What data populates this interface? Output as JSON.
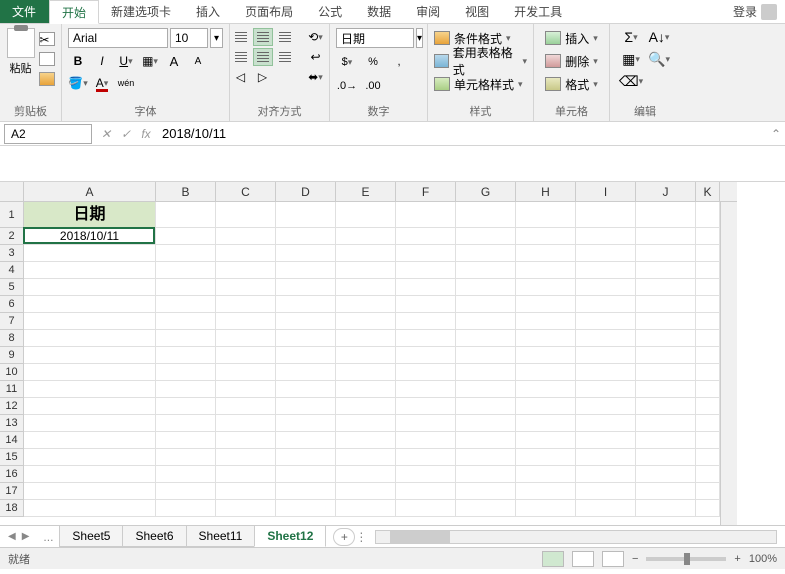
{
  "tabs": {
    "file": "文件",
    "home": "开始",
    "newtab": "新建选项卡",
    "insert": "插入",
    "layout": "页面布局",
    "formula": "公式",
    "data": "数据",
    "review": "审阅",
    "view": "视图",
    "dev": "开发工具",
    "login": "登录"
  },
  "ribbon": {
    "clipboard": {
      "label": "剪贴板",
      "paste": "粘贴"
    },
    "font": {
      "label": "字体",
      "name": "Arial",
      "size": "10",
      "bold": "B",
      "italic": "I",
      "underline": "U",
      "inc": "A",
      "dec": "A",
      "wen": "wén"
    },
    "align": {
      "label": "对齐方式"
    },
    "number": {
      "label": "数字",
      "format": "日期"
    },
    "styles": {
      "label": "样式",
      "cond": "条件格式",
      "table": "套用表格格式",
      "cell": "单元格样式"
    },
    "cells": {
      "label": "单元格",
      "insert": "插入",
      "delete": "删除",
      "format": "格式"
    },
    "edit": {
      "label": "编辑"
    }
  },
  "formula_bar": {
    "ref": "A2",
    "fx": "fx",
    "value": "2018/10/11"
  },
  "cols": [
    "A",
    "B",
    "C",
    "D",
    "E",
    "F",
    "G",
    "H",
    "I",
    "J",
    "K"
  ],
  "rows": [
    "1",
    "2",
    "3",
    "4",
    "5",
    "6",
    "7",
    "8",
    "9",
    "10",
    "11",
    "12",
    "13",
    "14",
    "15",
    "16",
    "17",
    "18"
  ],
  "cell_A1": "日期",
  "cell_A2": "2018/10/11",
  "sheet_tabs": {
    "s5": "Sheet5",
    "s6": "Sheet6",
    "s11": "Sheet11",
    "s12": "Sheet12",
    "dots": "..."
  },
  "status": {
    "ready": "就绪",
    "zoom": "100%"
  }
}
